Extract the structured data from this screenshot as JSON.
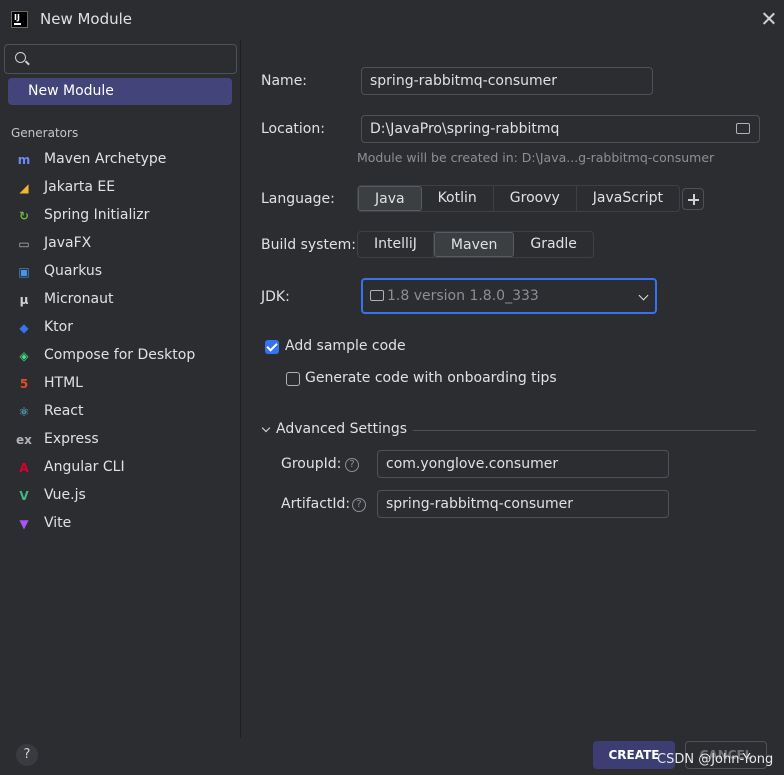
{
  "window": {
    "title": "New Module",
    "app_icon_text": "IJ"
  },
  "sidebar": {
    "selected": "New Module",
    "generators_header": "Generators",
    "generators": [
      {
        "label": "Maven Archetype",
        "icon": "maven-icon",
        "glyph": "m",
        "color": "#6b8bf5"
      },
      {
        "label": "Jakarta EE",
        "icon": "jakarta-icon",
        "glyph": "◢",
        "color": "#f2b632"
      },
      {
        "label": "Spring Initializr",
        "icon": "spring-icon",
        "glyph": "↻",
        "color": "#6db33f"
      },
      {
        "label": "JavaFX",
        "icon": "javafx-icon",
        "glyph": "▭",
        "color": "#aeb1b7"
      },
      {
        "label": "Quarkus",
        "icon": "quarkus-icon",
        "glyph": "▣",
        "color": "#4695eb"
      },
      {
        "label": "Micronaut",
        "icon": "micronaut-icon",
        "glyph": "μ",
        "color": "#cfd1d5"
      },
      {
        "label": "Ktor",
        "icon": "ktor-icon",
        "glyph": "◆",
        "color": "#3574f0"
      },
      {
        "label": "Compose for Desktop",
        "icon": "compose-icon",
        "glyph": "◈",
        "color": "#3ddc84"
      },
      {
        "label": "HTML",
        "icon": "html-icon",
        "glyph": "5",
        "color": "#e44d26"
      },
      {
        "label": "React",
        "icon": "react-icon",
        "glyph": "⚛",
        "color": "#61dafb"
      },
      {
        "label": "Express",
        "icon": "express-icon",
        "glyph": "ex",
        "color": "#aeb1b7"
      },
      {
        "label": "Angular CLI",
        "icon": "angular-icon",
        "glyph": "A",
        "color": "#dd0031"
      },
      {
        "label": "Vue.js",
        "icon": "vue-icon",
        "glyph": "V",
        "color": "#41b883"
      },
      {
        "label": "Vite",
        "icon": "vite-icon",
        "glyph": "▼",
        "color": "#a855f7"
      }
    ]
  },
  "form": {
    "name_label": "Name:",
    "name_value": "spring-rabbitmq-consumer",
    "location_label": "Location:",
    "location_value": "D:\\JavaPro\\spring-rabbitmq",
    "location_hint": "Module will be created in: D:\\Java...g-rabbitmq-consumer",
    "language_label": "Language:",
    "languages": [
      "Java",
      "Kotlin",
      "Groovy",
      "JavaScript"
    ],
    "build_label": "Build system:",
    "build_systems": [
      "IntelliJ",
      "Maven",
      "Gradle"
    ],
    "jdk_label": "JDK:",
    "jdk_value": "1.8 version 1.8.0_333",
    "sample_code_label": "Add sample code",
    "onboarding_label": "Generate code with onboarding tips",
    "advanced_label": "Advanced Settings",
    "groupid_label": "GroupId:",
    "groupid_value": "com.yonglove.consumer",
    "artifactid_label": "ArtifactId:",
    "artifactid_value": "spring-rabbitmq-consumer"
  },
  "footer": {
    "help": "?",
    "create": "CREATE",
    "cancel": "CANCEL",
    "watermark": "CSDN @John-Yong"
  }
}
